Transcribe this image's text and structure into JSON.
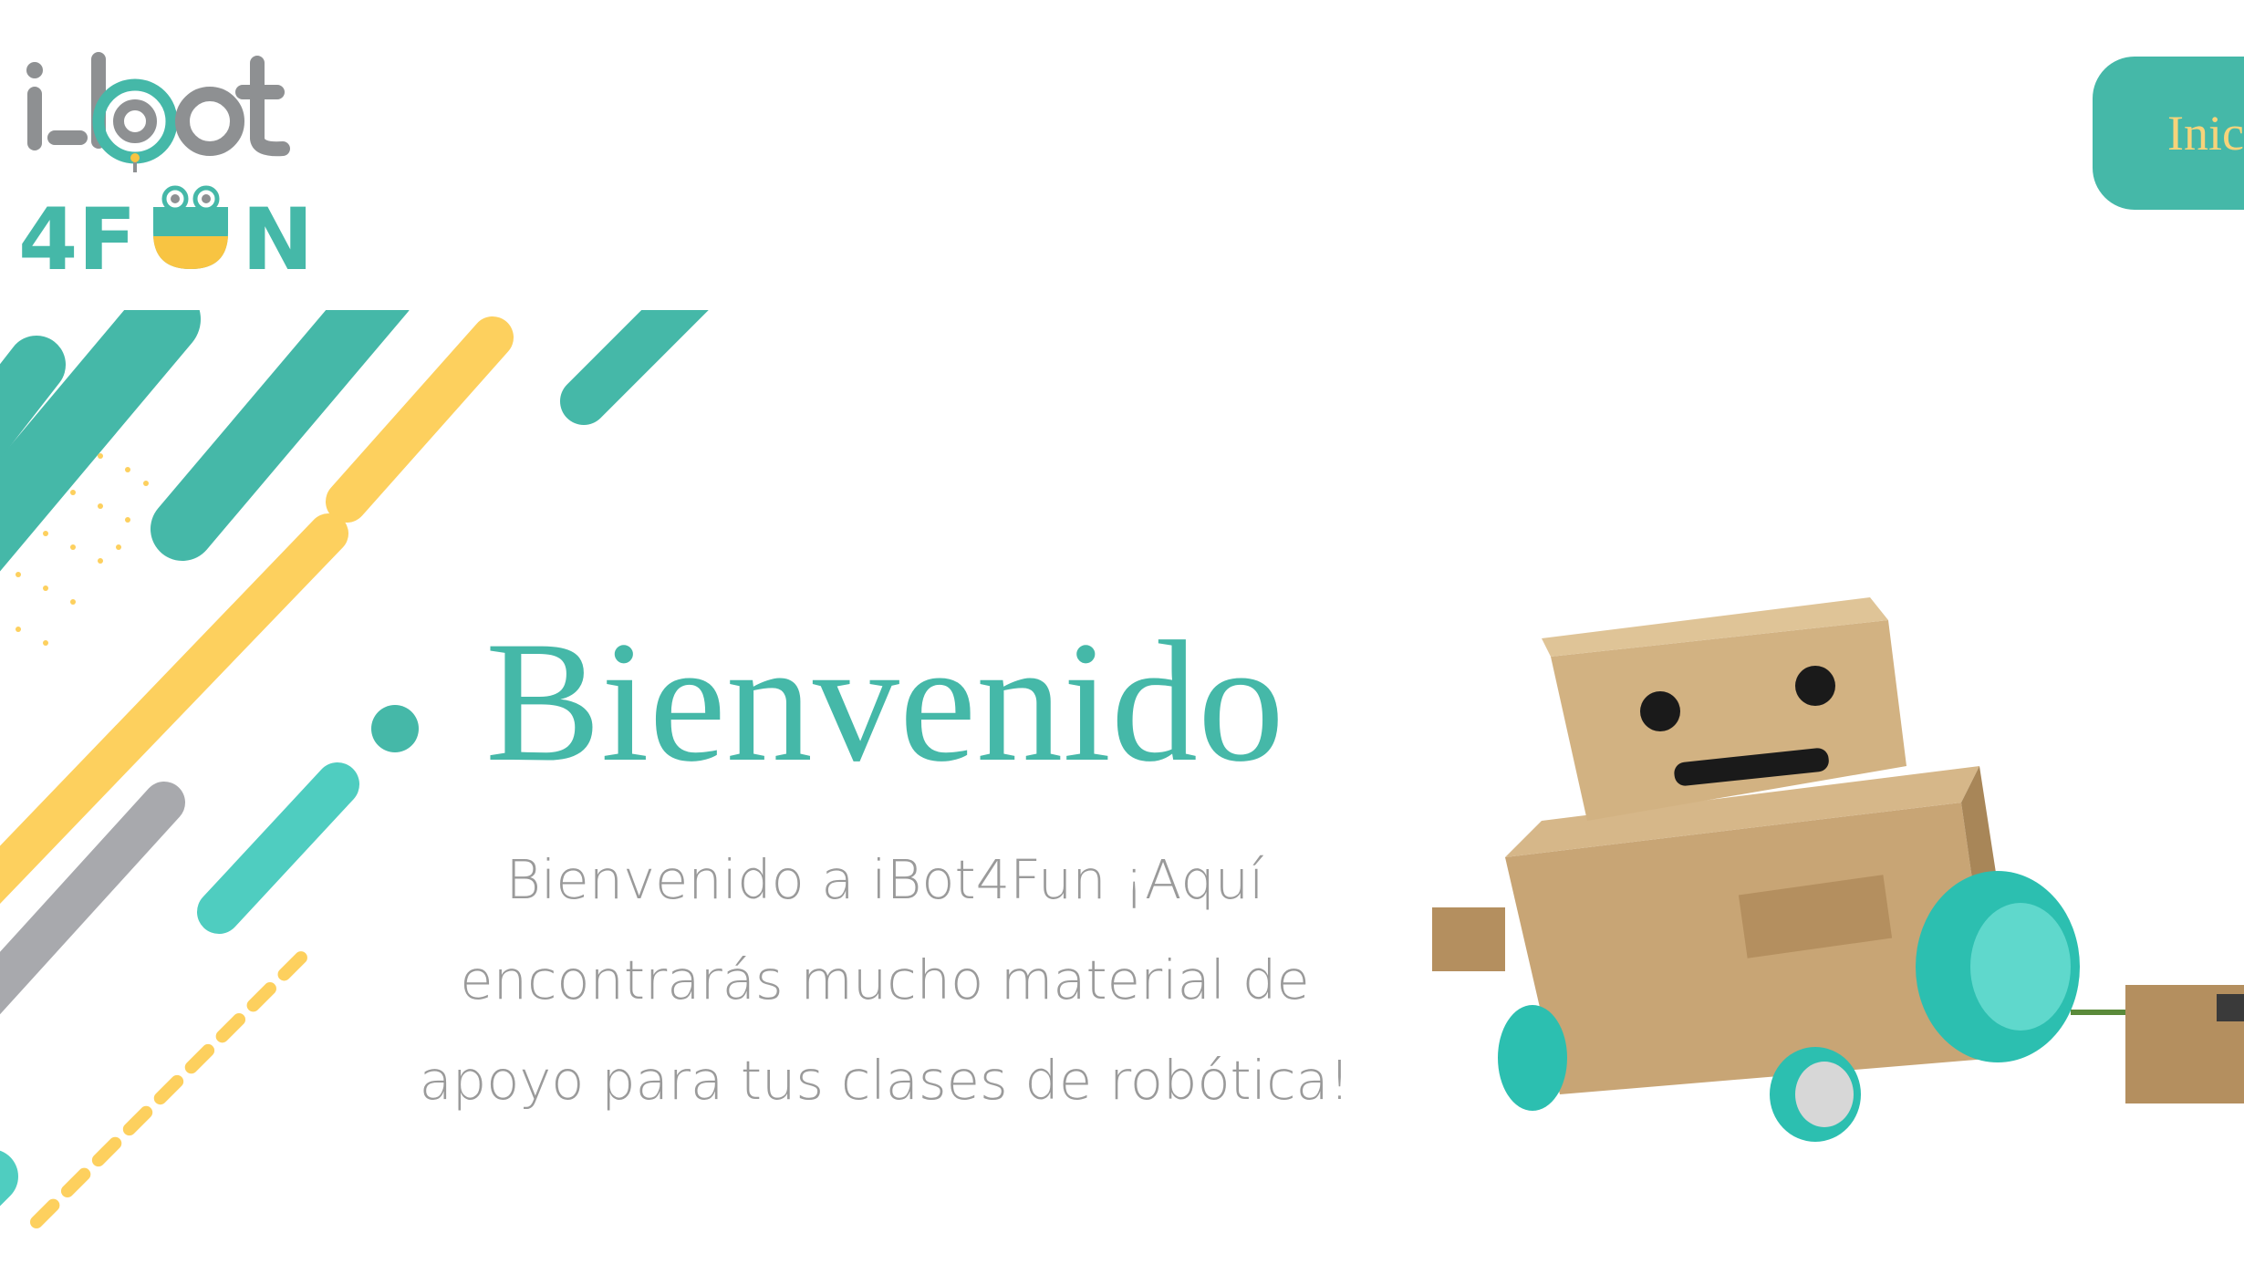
{
  "logo": {
    "top_text": "i-bot",
    "bottom_text": "4FUN",
    "colors": {
      "gray": "#8e9092",
      "teal": "#45b8a8",
      "yellow": "#f8c442"
    }
  },
  "nav": {
    "button_label": "Inicio"
  },
  "hero": {
    "title": "Bienvenido",
    "description": "Bienvenido a iBot4Fun ¡Aquí encontrarás mucho material de apoyo para tus clases de robótica!"
  },
  "images": {
    "robot": "cardboard-robot-photo"
  },
  "colors": {
    "accent": "#45b8a8",
    "secondary": "#fdd05e",
    "gray": "#a8a9ad",
    "text_gray": "#9a9a9a"
  }
}
